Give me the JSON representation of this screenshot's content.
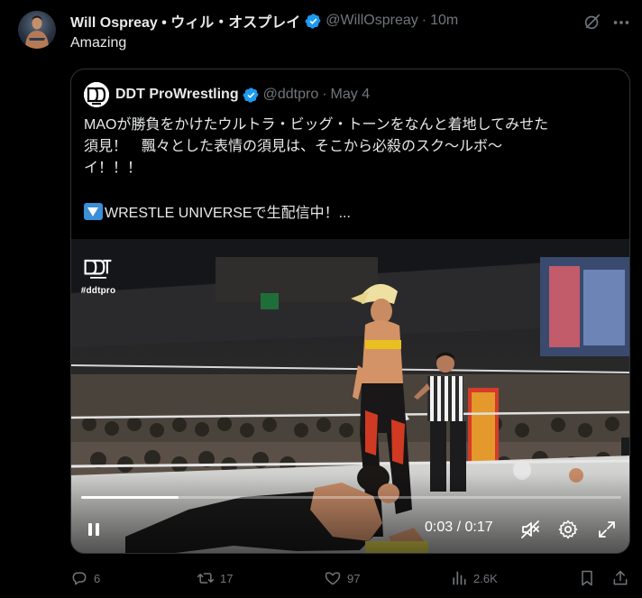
{
  "tweet": {
    "author": {
      "display_name": "Will Ospreay • ウィル・オスプレイ",
      "handle": "@WillOspreay",
      "time": "10m",
      "separator": "·"
    },
    "text": "Amazing"
  },
  "quote": {
    "author": {
      "display_name": "DDT ProWrestling",
      "handle": "@ddtpro",
      "time": "May 4",
      "separator": "·"
    },
    "lines": [
      "MAOが勝負をかけたウルトラ・ビッグ・トーンをなんと着地してみせた",
      "須見！　飄々とした表情の須見は、そこから必殺のスク〜ルボ〜",
      "イ！！！"
    ],
    "promo_line": "WRESTLE UNIVERSEで生配信中！..."
  },
  "video": {
    "watermark_tag": "#ddtpro",
    "current_time": "0:03",
    "duration": "0:17",
    "time_separator": " / ",
    "progress": 0.18,
    "playing": true,
    "muted": true
  },
  "actions": {
    "replies": "6",
    "reposts": "17",
    "likes": "97",
    "views": "2.6K"
  },
  "colors": {
    "background": "#000000",
    "text_primary": "#e7e9ea",
    "text_secondary": "#71767b",
    "border": "#2f3336",
    "verified": "#1d9bf0",
    "promo_icon": "#3b8ed8"
  },
  "icons": [
    "verified-badge-icon",
    "grok-icon",
    "more-icon",
    "pause-icon",
    "mute-icon",
    "settings-icon",
    "fullscreen-icon",
    "reply-icon",
    "repost-icon",
    "like-icon",
    "views-icon",
    "bookmark-icon",
    "share-icon"
  ]
}
